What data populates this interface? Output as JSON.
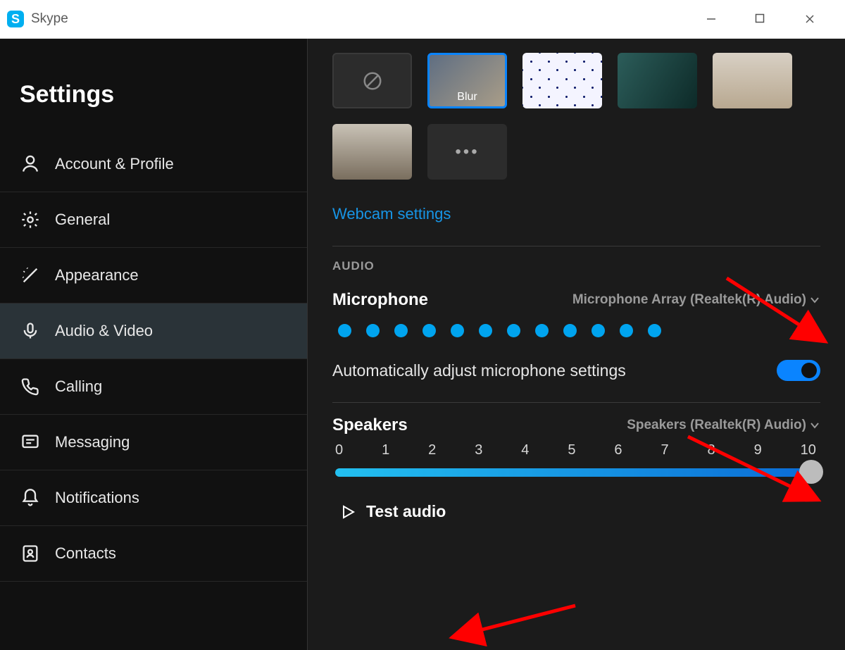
{
  "window": {
    "app_name": "Skype"
  },
  "sidebar": {
    "title": "Settings",
    "items": [
      {
        "label": "Account & Profile"
      },
      {
        "label": "General"
      },
      {
        "label": "Appearance"
      },
      {
        "label": "Audio & Video"
      },
      {
        "label": "Calling"
      },
      {
        "label": "Messaging"
      },
      {
        "label": "Notifications"
      },
      {
        "label": "Contacts"
      }
    ],
    "active_index": 3
  },
  "backgrounds": {
    "blur_label": "Blur"
  },
  "links": {
    "webcam_settings": "Webcam settings"
  },
  "audio": {
    "section_label": "AUDIO",
    "microphone_label": "Microphone",
    "microphone_device": "Microphone Array (Realtek(R) Audio)",
    "mic_level_dots": 12,
    "auto_adjust_label": "Automatically adjust microphone settings",
    "auto_adjust_on": true,
    "speakers_label": "Speakers",
    "speakers_device": "Speakers (Realtek(R) Audio)",
    "slider_ticks": [
      "0",
      "1",
      "2",
      "3",
      "4",
      "5",
      "6",
      "7",
      "8",
      "9",
      "10"
    ],
    "slider_value": 10,
    "test_audio_label": "Test audio"
  }
}
